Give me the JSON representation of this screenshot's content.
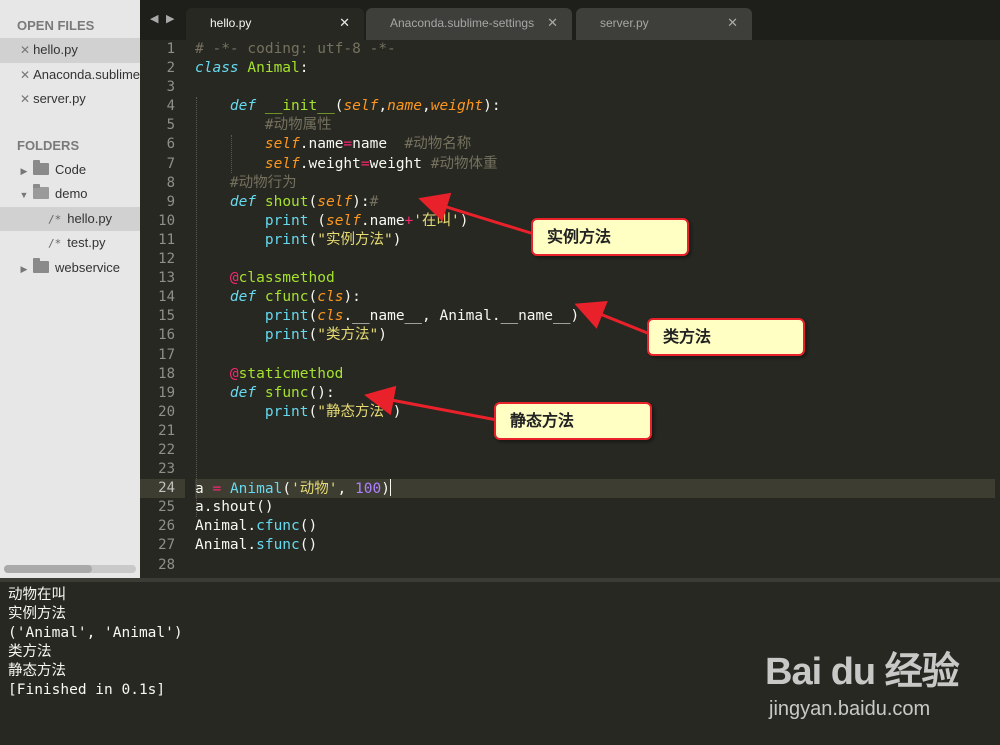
{
  "sidebar": {
    "open_files_heading": "OPEN FILES",
    "open_files": [
      {
        "name": "hello.py",
        "selected": true
      },
      {
        "name": "Anaconda.sublime-settings",
        "selected": false
      },
      {
        "name": "server.py",
        "selected": false
      }
    ],
    "folders_heading": "FOLDERS",
    "tree": [
      {
        "name": "Code",
        "type": "folder",
        "expanded": false
      },
      {
        "name": "demo",
        "type": "folder",
        "expanded": true
      },
      {
        "name": "hello.py",
        "type": "file",
        "icon": "/*",
        "selected": true
      },
      {
        "name": "test.py",
        "type": "file",
        "icon": "/*",
        "selected": false
      },
      {
        "name": "webservice",
        "type": "folder",
        "expanded": false
      }
    ]
  },
  "tabs": [
    {
      "label": "hello.py",
      "active": true
    },
    {
      "label": "Anaconda.sublime-settings",
      "active": false
    },
    {
      "label": "server.py",
      "active": false
    }
  ],
  "editor": {
    "current_line": 24,
    "line_numbers": [
      "1",
      "2",
      "3",
      "4",
      "5",
      "6",
      "7",
      "8",
      "9",
      "10",
      "11",
      "12",
      "13",
      "14",
      "15",
      "16",
      "17",
      "18",
      "19",
      "20",
      "21",
      "22",
      "23",
      "24",
      "25",
      "26",
      "27",
      "28"
    ],
    "text": {
      "l1": "# -*- coding: utf-8 -*-",
      "class_kw": "class",
      "class_name": "Animal",
      "def_kw": "def",
      "init_name": "__init__",
      "self": "self",
      "name": "name",
      "weight": "weight",
      "c5": "#动物属性",
      "c6": "#动物名称",
      "c7": "#动物体重",
      "c8": "#动物行为",
      "shout": "shout",
      "c9": "#",
      "print": "print",
      "s10": "'在叫'",
      "s11": "\"实例方法\"",
      "dec_classmethod": "classmethod",
      "cfunc": "cfunc",
      "cls": "cls",
      "dunder_name": "__name__",
      "animal_ref": "Animal",
      "s16": "\"类方法\"",
      "dec_staticmethod": "staticmethod",
      "sfunc": "sfunc",
      "s20": "\"静态方法\"",
      "var_a": "a",
      "s24": "'动物'",
      "n24": "100",
      "l25": "a.shout()",
      "l26_obj": "Animal.",
      "l26_fn": "cfunc",
      "l26_end": "()",
      "l27_obj": "Animal.",
      "l27_fn": "sfunc",
      "l27_end": "()"
    }
  },
  "console": {
    "lines": [
      "动物在叫",
      "实例方法",
      "('Animal', 'Animal')",
      "类方法",
      "静态方法",
      "[Finished in 0.1s]"
    ]
  },
  "callouts": {
    "instance": "实例方法",
    "class": "类方法",
    "static": "静态方法"
  },
  "watermark": {
    "logo": "Bai du 经验",
    "url": "jingyan.baidu.com"
  },
  "colors": {
    "editor_bg": "#272822",
    "keyword": "#66d9ef",
    "function": "#a6e22e",
    "string": "#e6db74",
    "comment": "#75715e",
    "operator": "#f92672",
    "param": "#fd971f",
    "number": "#ae81ff",
    "callout_bg": "#ffffc4",
    "callout_border": "#e8212a"
  }
}
